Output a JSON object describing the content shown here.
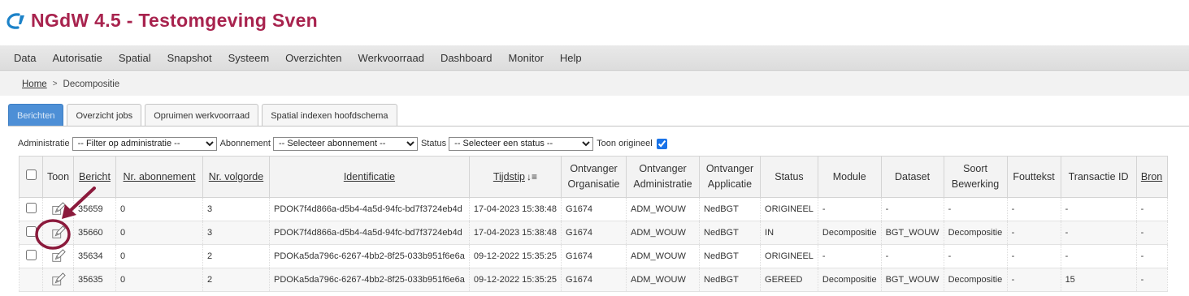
{
  "app": {
    "title": "NGdW 4.5 - Testomgeving Sven"
  },
  "menu": [
    "Data",
    "Autorisatie",
    "Spatial",
    "Snapshot",
    "Systeem",
    "Overzichten",
    "Werkvoorraad",
    "Dashboard",
    "Monitor",
    "Help"
  ],
  "breadcrumb": {
    "home": "Home",
    "separator": ">",
    "current": "Decompositie"
  },
  "tabs": [
    {
      "label": "Berichten",
      "active": true
    },
    {
      "label": "Overzicht jobs",
      "active": false
    },
    {
      "label": "Opruimen werkvoorraad",
      "active": false
    },
    {
      "label": "Spatial indexen hoofdschema",
      "active": false
    }
  ],
  "filters": {
    "administratie_label": "Administratie",
    "administratie_value": "-- Filter op administratie --",
    "abonnement_label": "Abonnement",
    "abonnement_value": "-- Selecteer abonnement --",
    "status_label": "Status",
    "status_value": "-- Selecteer een status --",
    "toon_origineel_label": "Toon origineel",
    "toon_origineel_checked": true
  },
  "table": {
    "headers": {
      "toon": "Toon",
      "bericht": "Bericht",
      "nr_abonnement": "Nr. abonnement",
      "nr_volgorde": "Nr. volgorde",
      "identificatie": "Identificatie",
      "tijdstip": "Tijdstip",
      "ontvanger_organisatie_1": "Ontvanger",
      "ontvanger_organisatie_2": "Organisatie",
      "ontvanger_administratie_1": "Ontvanger",
      "ontvanger_administratie_2": "Administratie",
      "ontvanger_applicatie_1": "Ontvanger",
      "ontvanger_applicatie_2": "Applicatie",
      "status": "Status",
      "module": "Module",
      "dataset": "Dataset",
      "soort_bewerking_1": "Soort",
      "soort_bewerking_2": "Bewerking",
      "fouttekst": "Fouttekst",
      "transactie_id": "Transactie ID",
      "bron": "Bron"
    },
    "rows": [
      {
        "has_checkbox": true,
        "bericht": "35659",
        "nr_abonnement": "0",
        "nr_volgorde": "3",
        "identificatie": "PDOK7f4d866a-d5b4-4a5d-94fc-bd7f3724eb4d",
        "tijdstip": "17-04-2023 15:38:48",
        "organisatie": "G1674",
        "administratie": "ADM_WOUW",
        "applicatie": "NedBGT",
        "status": "ORIGINEEL",
        "module": "-",
        "dataset": "-",
        "soort_bewerking": "-",
        "fouttekst": "-",
        "transactie_id": "-",
        "bron": "-"
      },
      {
        "has_checkbox": true,
        "bericht": "35660",
        "nr_abonnement": "0",
        "nr_volgorde": "3",
        "identificatie": "PDOK7f4d866a-d5b4-4a5d-94fc-bd7f3724eb4d",
        "tijdstip": "17-04-2023 15:38:48",
        "organisatie": "G1674",
        "administratie": "ADM_WOUW",
        "applicatie": "NedBGT",
        "status": "IN",
        "module": "Decompositie",
        "dataset": "BGT_WOUW",
        "soort_bewerking": "Decompositie",
        "fouttekst": "-",
        "transactie_id": "-",
        "bron": "-"
      },
      {
        "has_checkbox": true,
        "bericht": "35634",
        "nr_abonnement": "0",
        "nr_volgorde": "2",
        "identificatie": "PDOKa5da796c-6267-4bb2-8f25-033b951f6e6a",
        "tijdstip": "09-12-2022 15:35:25",
        "organisatie": "G1674",
        "administratie": "ADM_WOUW",
        "applicatie": "NedBGT",
        "status": "ORIGINEEL",
        "module": "-",
        "dataset": "-",
        "soort_bewerking": "-",
        "fouttekst": "-",
        "transactie_id": "-",
        "bron": "-"
      },
      {
        "has_checkbox": false,
        "bericht": "35635",
        "nr_abonnement": "0",
        "nr_volgorde": "2",
        "identificatie": "PDOKa5da796c-6267-4bb2-8f25-033b951f6e6a",
        "tijdstip": "09-12-2022 15:35:25",
        "organisatie": "G1674",
        "administratie": "ADM_WOUW",
        "applicatie": "NedBGT",
        "status": "GEREED",
        "module": "Decompositie",
        "dataset": "BGT_WOUW",
        "soort_bewerking": "Decompositie",
        "fouttekst": "-",
        "transactie_id": "15",
        "bron": "-"
      }
    ]
  },
  "icons": {
    "logo": "logo-icon",
    "view": "pencil-icon",
    "sort": "sort-desc-icon",
    "breadcrumb_sep": "chevron-right-icon"
  },
  "colors": {
    "title": "#a8234e",
    "logo": "#1c82c8",
    "active_tab": "#4d8fd6",
    "annotation": "#8b1a3c"
  }
}
